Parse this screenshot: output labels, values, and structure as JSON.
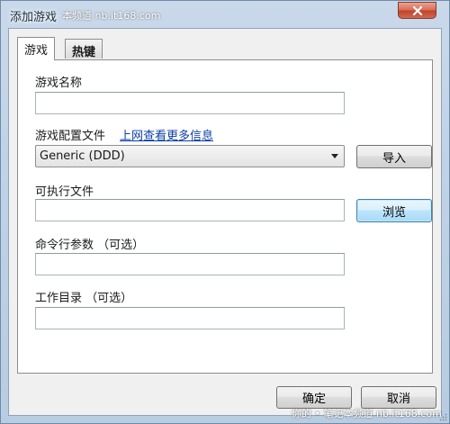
{
  "window": {
    "title": "添加游戏",
    "watermark_top": "本频道 nb.it168.com",
    "watermark_bottom": "你的 • 笔记本频道 nb.it168.com"
  },
  "tabs": [
    {
      "label": "游戏",
      "active": true
    },
    {
      "label": "热键",
      "active": false
    }
  ],
  "form": {
    "game_name_label": "游戏名称",
    "game_name_value": "",
    "profile_label": "游戏配置文件",
    "profile_link": "上网查看更多信息",
    "profile_value": "Generic (DDD)",
    "import_button": "导入",
    "executable_label": "可执行文件",
    "executable_value": "",
    "browse_button": "浏览",
    "cmdline_label": "命令行参数 （可选）",
    "cmdline_value": "",
    "workdir_label": "工作目录 （可选）",
    "workdir_value": ""
  },
  "footer": {
    "ok_button": "确定",
    "cancel_button": "取消"
  },
  "icons": {
    "close": "close-icon",
    "dropdown": "chevron-down-icon",
    "resize": "resize-grip-icon"
  },
  "colors": {
    "link": "#0b3fa7",
    "close_button": "#c2432a",
    "focus_button": "#3c7fb1"
  }
}
